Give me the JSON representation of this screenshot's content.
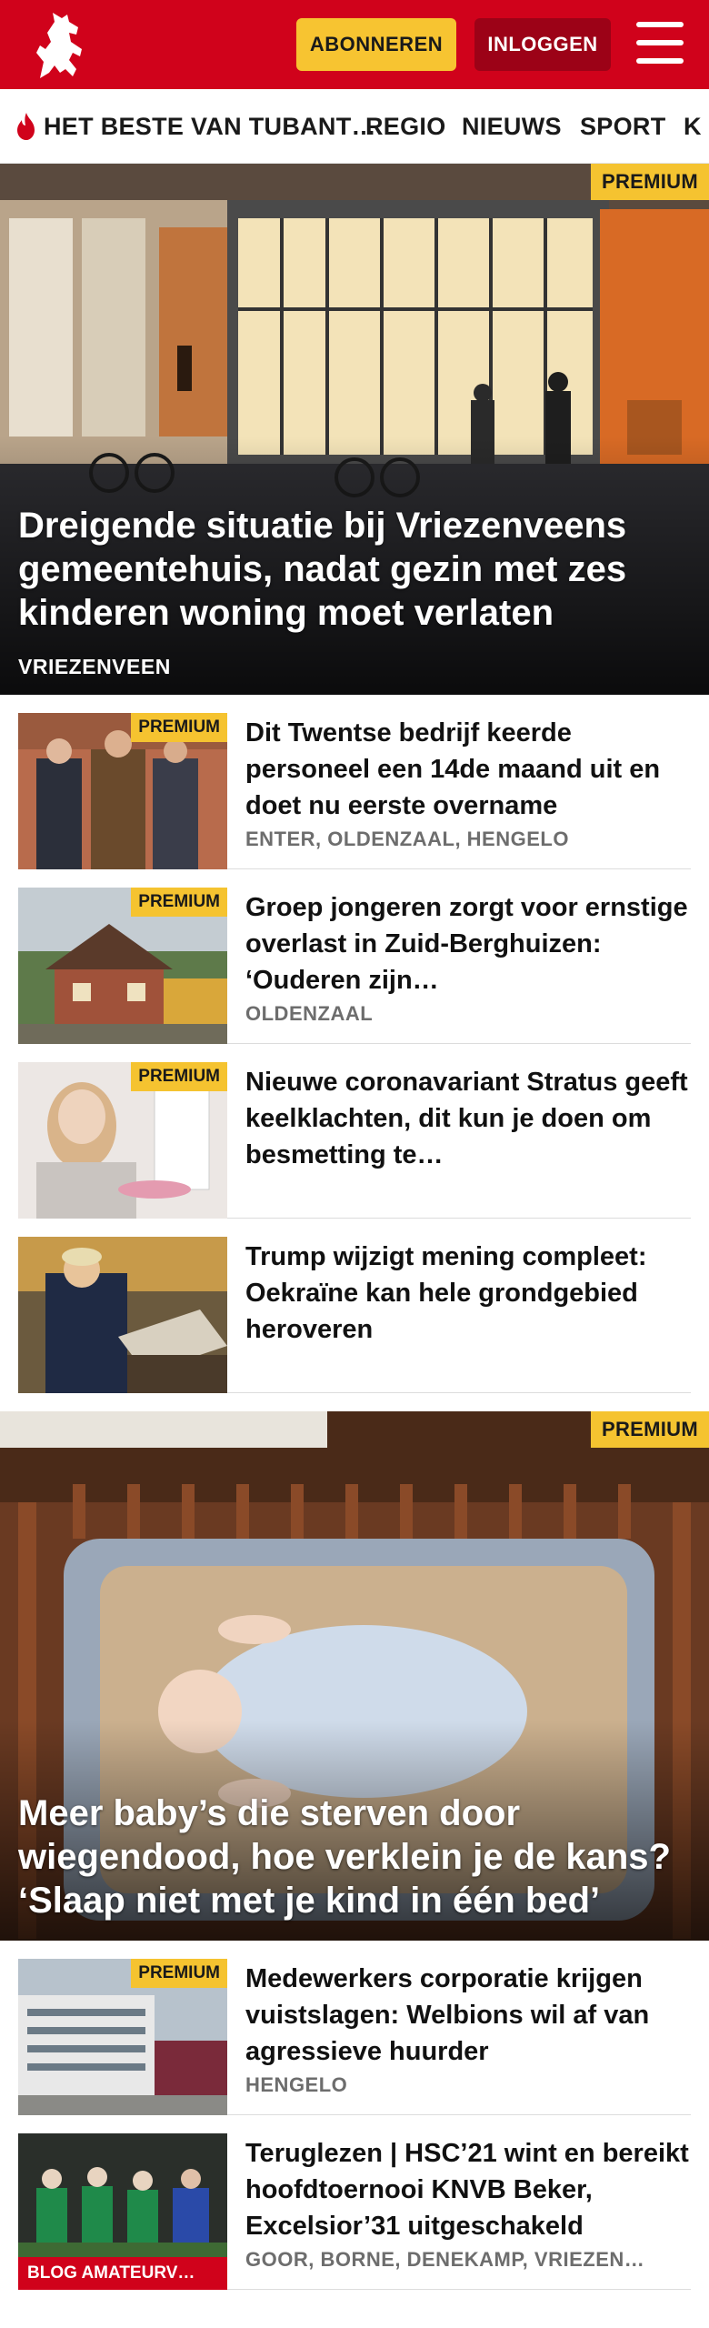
{
  "header": {
    "subscribe_label": "ABONNEREN",
    "login_label": "INLOGGEN",
    "brand_color": "#d0021b"
  },
  "nav": {
    "items": [
      "HET BESTE VAN TUBANT…",
      "REGIO",
      "NIEUWS",
      "SPORT",
      "K"
    ]
  },
  "premium_label": "PREMIUM",
  "hero1": {
    "title": "Dreigende situatie bij Vriezenveens gemeentehuis, nadat gezin met zes kinderen woning moet verlaten",
    "location": "VRIEZENVEEN"
  },
  "articles": [
    {
      "title": "Dit Twentse bedrijf keerde personeel een 14de maand uit en doet nu eerste overname",
      "location": "ENTER, OLDENZAAL, HENGELO",
      "premium": true
    },
    {
      "title": "Groep jongeren zorgt voor ernstige overlast in Zuid-Berghuizen: ‘Ouderen zijn…",
      "location": "OLDENZAAL",
      "premium": true
    },
    {
      "title": "Nieuwe coronavariant Stratus geeft keelklachten, dit kun je doen om besmetting te…",
      "location": "",
      "premium": true
    },
    {
      "title": "Trump wijzigt mening compleet: Oekraïne kan hele grondgebied heroveren",
      "location": "",
      "premium": false
    }
  ],
  "hero2": {
    "title": "Meer baby’s die sterven door wiegendood, hoe verklein je de kans? ‘Slaap niet met je kind in één bed’"
  },
  "articles2": [
    {
      "title": "Medewerkers corporatie krijgen vuistslagen: Welbions wil af van agressieve huurder",
      "location": "HENGELO",
      "premium": true
    },
    {
      "title": "Teruglezen | HSC’21 wint en bereikt hoofdtoernooi KNVB Beker, Excelsior’31 uitgeschakeld",
      "location": "GOOR, BORNE, DENEKAMP, VRIEZEN…",
      "tag": "BLOG AMATEURV…"
    }
  ],
  "icons": [
    "horse-logo-icon",
    "hamburger-menu-icon",
    "flame-icon"
  ]
}
